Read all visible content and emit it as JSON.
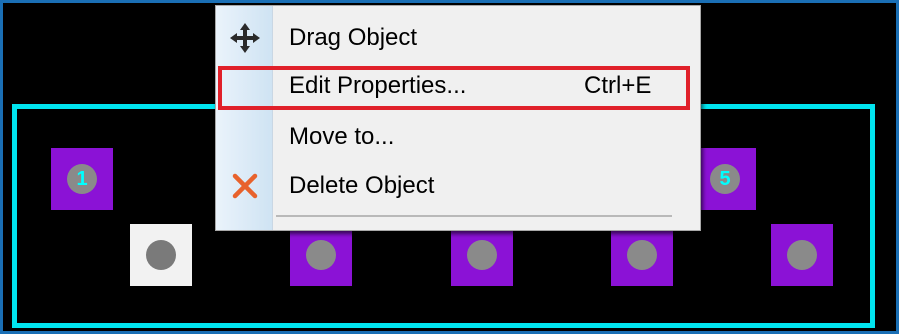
{
  "pcb": {
    "outline_color": "#00e5f0",
    "pad_color": "#8b12d6",
    "pin1_pad_color": "#f2f2f2",
    "pads": [
      {
        "label": "1"
      },
      {
        "label": "5"
      }
    ]
  },
  "context_menu": {
    "items": [
      {
        "icon": "move-arrows-icon",
        "label": "Drag Object",
        "shortcut": ""
      },
      {
        "icon": "",
        "label": "Edit Properties...",
        "shortcut": "Ctrl+E",
        "selected": true
      },
      {
        "icon": "",
        "label": "Move to...",
        "shortcut": ""
      },
      {
        "icon": "delete-x-icon",
        "label": "Delete Object",
        "shortcut": ""
      }
    ],
    "highlight_color": "#e0202a"
  }
}
